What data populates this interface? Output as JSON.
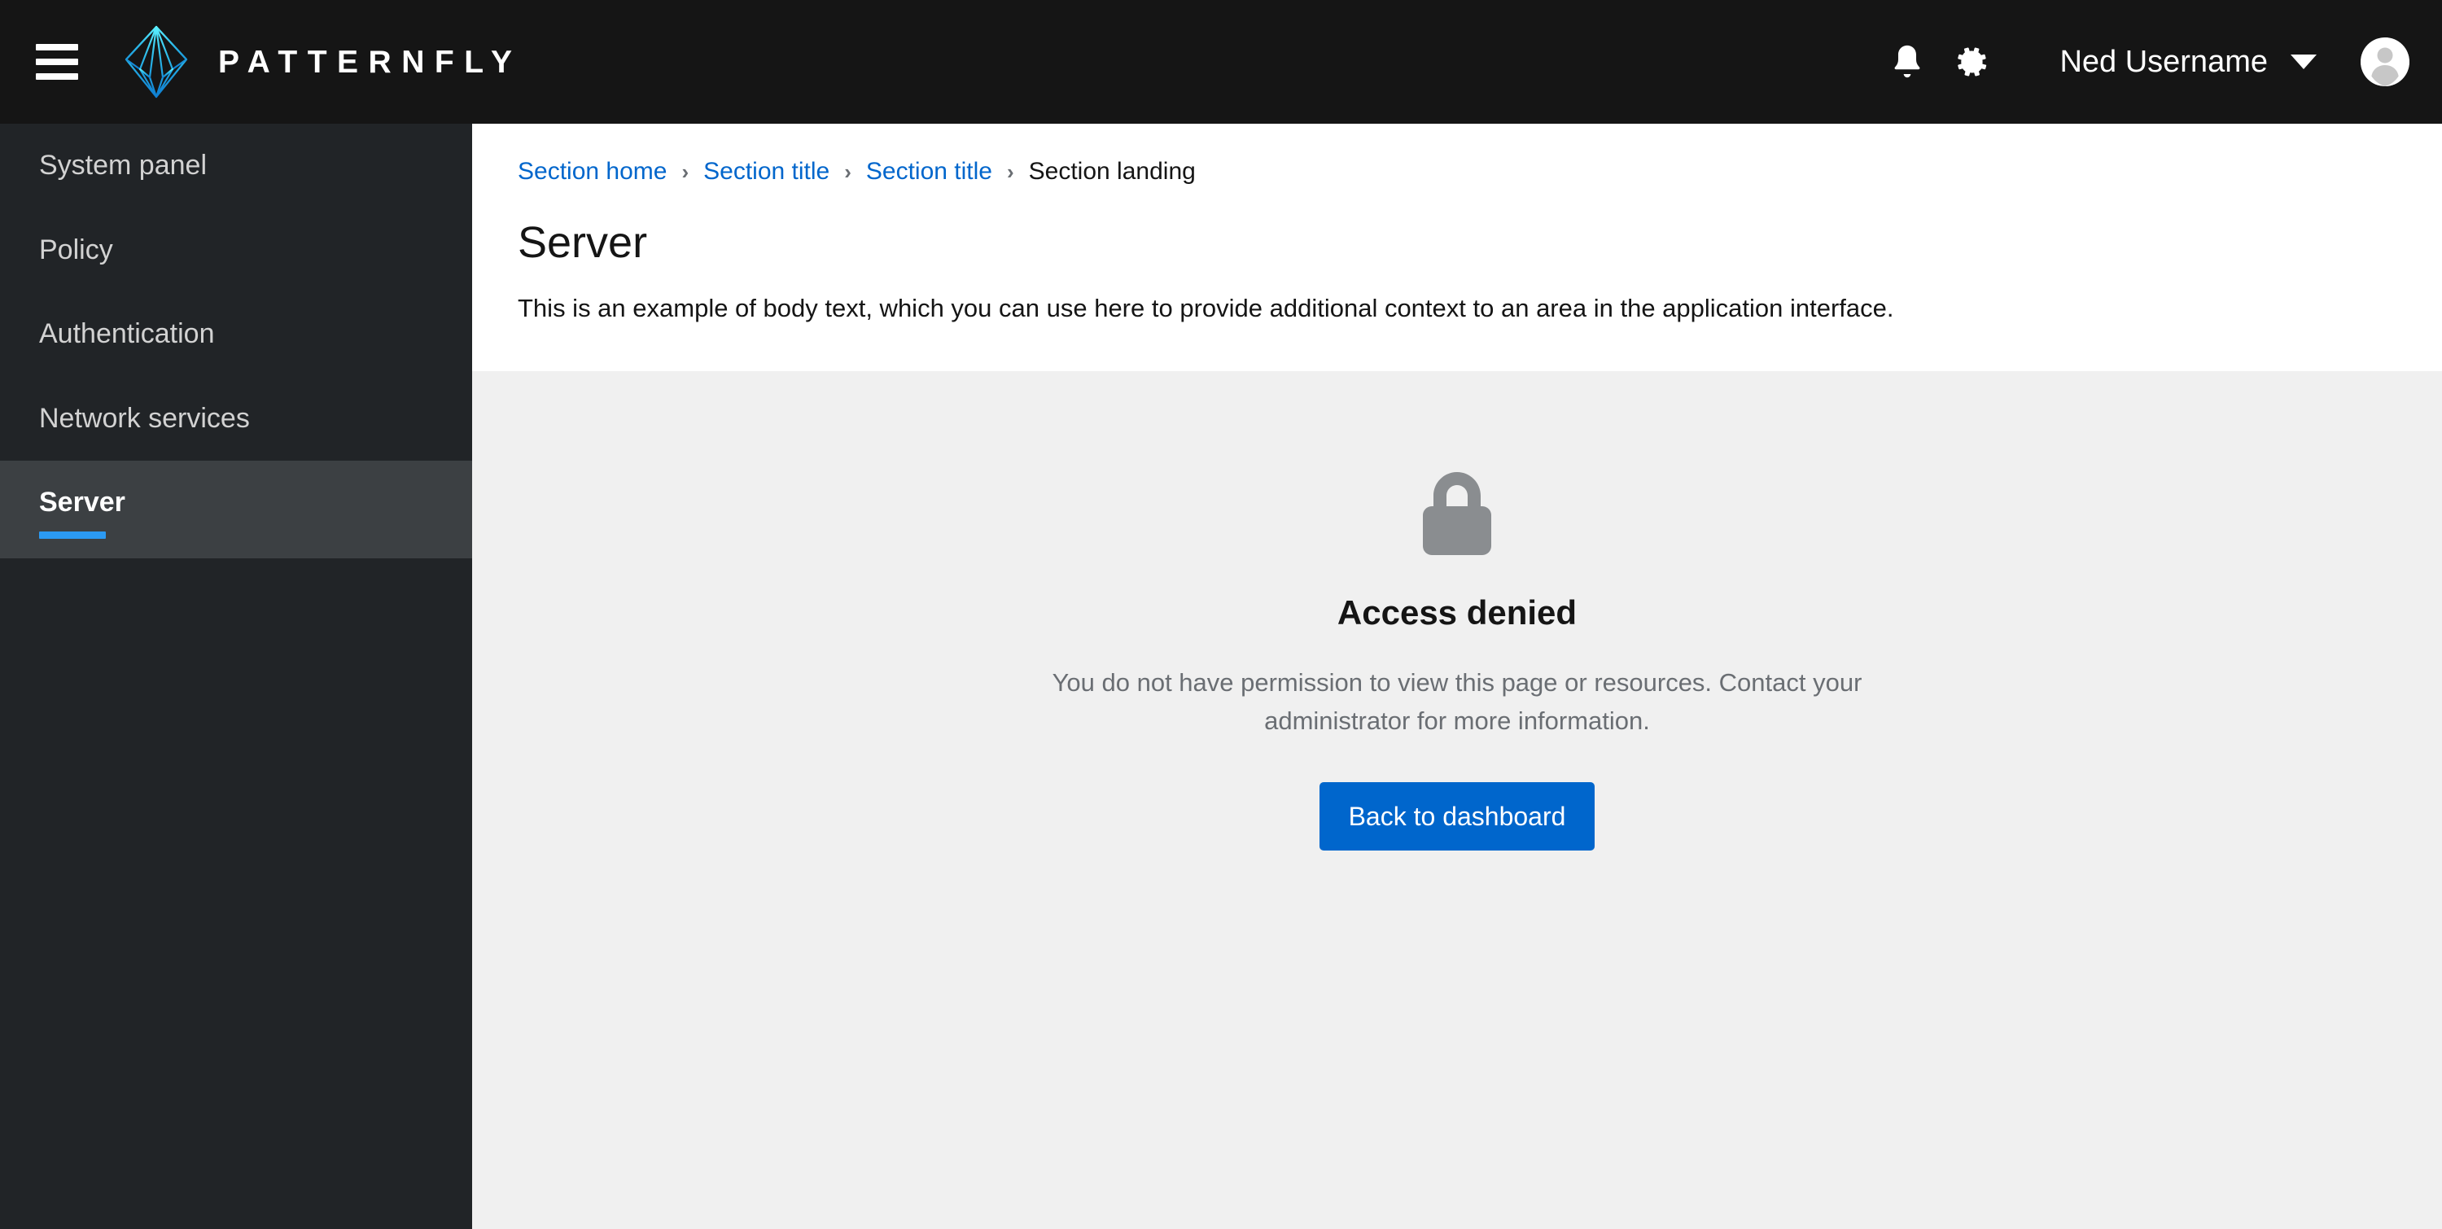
{
  "masthead": {
    "menu_toggle_label": "Global navigation",
    "brand_name": "PATTERNFLY",
    "notifications_label": "Notifications",
    "settings_label": "Settings",
    "user_name": "Ned Username"
  },
  "sidebar": {
    "items": [
      {
        "label": "System panel",
        "active": false
      },
      {
        "label": "Policy",
        "active": false
      },
      {
        "label": "Authentication",
        "active": false
      },
      {
        "label": "Network services",
        "active": false
      },
      {
        "label": "Server",
        "active": true
      }
    ]
  },
  "breadcrumb": {
    "items": [
      {
        "label": "Section home",
        "current": false
      },
      {
        "label": "Section title",
        "current": false
      },
      {
        "label": "Section title",
        "current": false
      },
      {
        "label": "Section landing",
        "current": true
      }
    ],
    "separator": "›"
  },
  "page_header": {
    "title": "Server",
    "subtitle": "This is an example of body text, which you can use here to provide additional context to an area in the application interface."
  },
  "empty_state": {
    "icon": "lock-icon",
    "title": "Access denied",
    "body": "You do not have permission to view this page or resources. Contact your administrator for more information.",
    "button_label": "Back to dashboard"
  },
  "colors": {
    "masthead_bg": "#151515",
    "sidebar_bg": "#212427",
    "sidebar_active_bg": "#3c4043",
    "accent_blue": "#2b9af3",
    "link_blue": "#0066cc",
    "primary_button": "#0066cc",
    "body_bg": "#f0f0f0",
    "icon_gray": "#8a8d90",
    "text_muted": "#6a6e73",
    "text_dark": "#151515",
    "logo_cyan": "#40e0f0"
  }
}
